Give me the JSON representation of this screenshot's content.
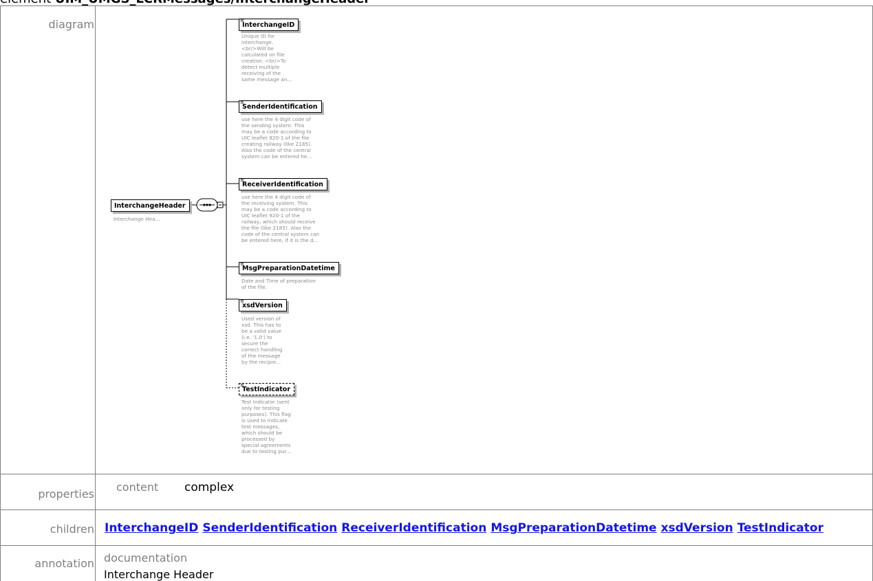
{
  "page_title": {
    "prefix": "element ",
    "path": "UIM_UMGS_LCRMessages/InterchangeHeader"
  },
  "rows": {
    "diagram": "diagram",
    "properties": "properties",
    "children": "children",
    "annotation": "annotation"
  },
  "diagram": {
    "root": {
      "name": "InterchangeHeader",
      "doc": "Interchange Hea..."
    },
    "elements": [
      {
        "name": "InterchangeID",
        "doc": "Unique ID for\ninterchange.\n<br/>Will be\ncalculated on file\ncreation. <br/>To\ndetect multiple\nreceiving of the\nsame message an...",
        "optional": false
      },
      {
        "name": "SenderIdentification",
        "doc": "use here the 4 digit code of\nthe sending system. This\nmay be a code according to\nUIC leaflet 920-1 of the file\ncreating railway (like 2185).\nAlso the code of the central\nsystem can be entered he...",
        "optional": false
      },
      {
        "name": "ReceiverIdentification",
        "doc": "use here the 4 digit code of\nthe receiving system. This\nmay be a code according to\nUIC leaflet 920-1 of the\nrailway, which should receive\nthe file (like 2185). Also the\ncode of the central system can\nbe entered here, if it is the d...",
        "optional": false
      },
      {
        "name": "MsgPreparationDatetime",
        "doc": "Date and Time of preparation\nof the file.",
        "optional": false
      },
      {
        "name": "xsdVersion",
        "doc": "Used version of\nxsd. This has to\nbe a valid value\n(i.e. '1.0') to\nsecure the\ncorrect handling\nof the message\nby the recipie...",
        "optional": false
      },
      {
        "name": "TestIndicator",
        "doc": "Test Indicator (sent\nonly for testing\npurposes). This flag\nis used to indicate\ntest messages,\nwhich should be\nprocessed by\nspecial agreements\ndue to testing pur...",
        "optional": true
      }
    ]
  },
  "properties": {
    "key": "content",
    "value": "complex"
  },
  "children": [
    "InterchangeID",
    "SenderIdentification",
    "ReceiverIdentification",
    "MsgPreparationDatetime",
    "xsdVersion",
    "TestIndicator"
  ],
  "annotation": {
    "key": "documentation",
    "value": "Interchange Header"
  }
}
